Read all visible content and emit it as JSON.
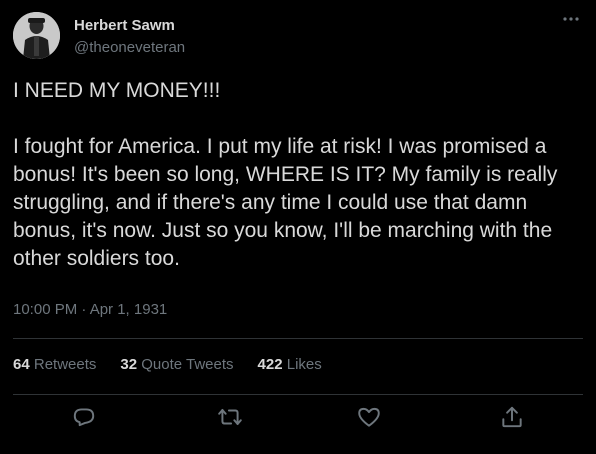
{
  "author": {
    "name": "Herbert Sawm",
    "handle": "@theoneveteran"
  },
  "tweet": {
    "headline": "I NEED MY MONEY!!!",
    "body": "I fought for America. I put my life at risk! I was promised a bonus! It's been so long, WHERE IS IT? My family is really struggling, and if there's any time I could use that damn bonus, it's now. Just so you know, I'll be marching with the other soldiers too.",
    "timestamp": "10:00 PM · Apr 1, 1931"
  },
  "stats": {
    "retweets_count": "64",
    "retweets_label": "Retweets",
    "quotes_count": "32",
    "quotes_label": "Quote Tweets",
    "likes_count": "422",
    "likes_label": "Likes"
  },
  "actions": [
    "reply-icon",
    "retweet-icon",
    "like-icon",
    "share-icon"
  ],
  "colors": {
    "background": "#000000",
    "text": "#d9d9d9",
    "muted": "#6e767d",
    "divider": "#2f3336"
  }
}
